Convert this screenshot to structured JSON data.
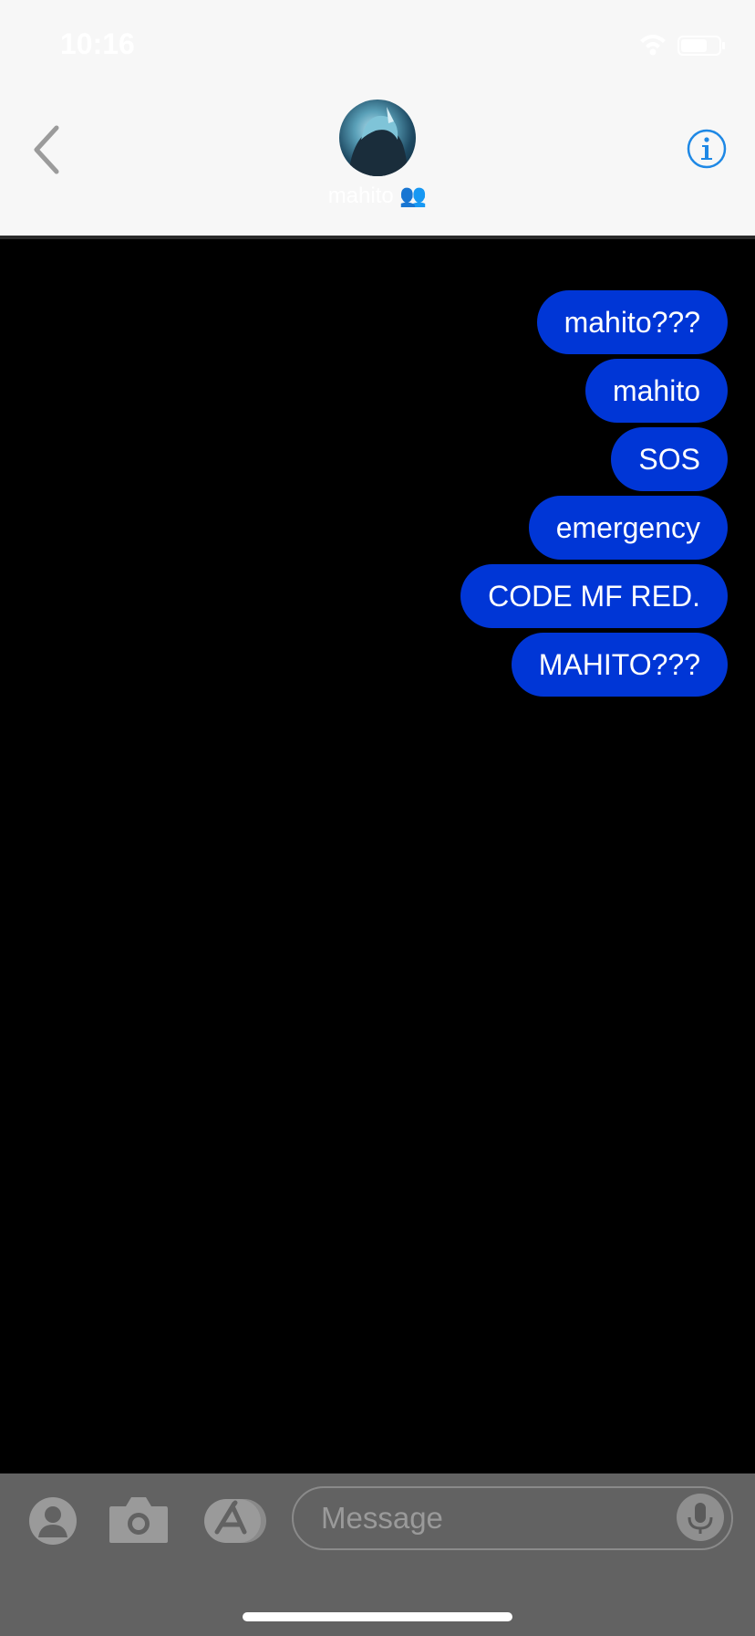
{
  "status_bar": {
    "time": "10:16"
  },
  "header": {
    "contact_name": "mahito",
    "contact_emoji": "👥"
  },
  "messages": [
    {
      "text": "mahito???"
    },
    {
      "text": "mahito"
    },
    {
      "text": "SOS"
    },
    {
      "text": "emergency"
    },
    {
      "text": "CODE MF RED."
    },
    {
      "text": "MAHITO???"
    }
  ],
  "composer": {
    "placeholder": "Message"
  },
  "colors": {
    "bubble": "#0036d6",
    "header_bg": "#f7f7f7",
    "accent": "#1e88e5",
    "input_bar_bg": "#626262"
  },
  "icons": [
    "chevron-left-icon",
    "info-icon",
    "wifi-icon",
    "battery-icon",
    "contact-icon",
    "camera-icon",
    "app-store-icon",
    "microphone-icon"
  ]
}
